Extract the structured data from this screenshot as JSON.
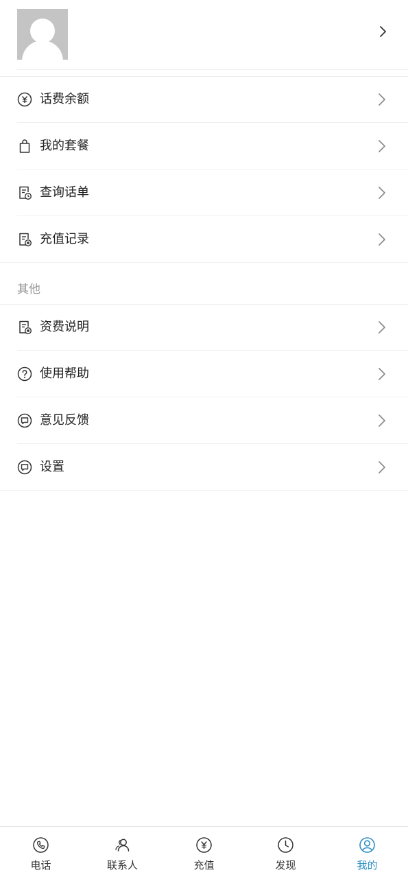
{
  "profile": {
    "name": "",
    "sub": ""
  },
  "menu_main": [
    {
      "label": "话费余额",
      "icon": "yuan-circle-icon"
    },
    {
      "label": "我的套餐",
      "icon": "shopping-bag-icon"
    },
    {
      "label": "查询话单",
      "icon": "bill-clock-icon"
    },
    {
      "label": "充值记录",
      "icon": "bill-record-icon"
    }
  ],
  "section_other": {
    "title": "其他"
  },
  "menu_other": [
    {
      "label": "资费说明",
      "icon": "bill-record-icon"
    },
    {
      "label": "使用帮助",
      "icon": "help-circle-icon"
    },
    {
      "label": "意见反馈",
      "icon": "feedback-icon"
    },
    {
      "label": "设置",
      "icon": "settings-icon"
    }
  ],
  "tabs": [
    {
      "label": "电话",
      "icon": "phone-icon",
      "active": false
    },
    {
      "label": "联系人",
      "icon": "contacts-icon",
      "active": false
    },
    {
      "label": "充值",
      "icon": "yuan-circle-icon",
      "active": false
    },
    {
      "label": "发现",
      "icon": "clock-icon",
      "active": false
    },
    {
      "label": "我的",
      "icon": "user-circle-icon",
      "active": true
    }
  ],
  "colors": {
    "accent": "#2b8ec4",
    "text": "#222222",
    "muted": "#9a9a9a",
    "icon": "#333333",
    "chevron": "#888888",
    "avatar_bg": "#c4c4c4"
  }
}
